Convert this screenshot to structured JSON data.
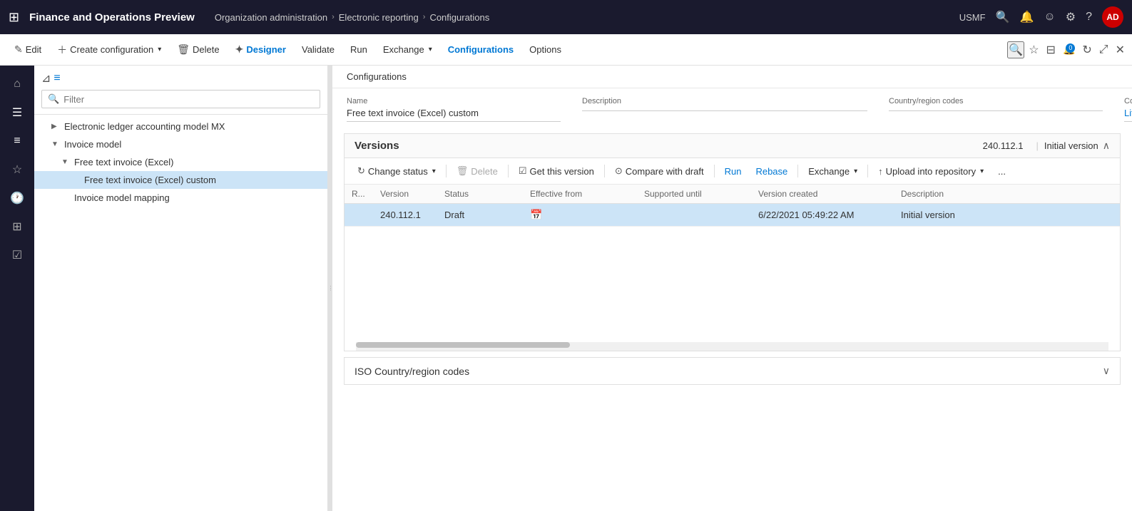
{
  "app": {
    "title": "Finance and Operations Preview",
    "grid_icon": "⊞"
  },
  "breadcrumb": {
    "items": [
      "Organization administration",
      "Electronic reporting",
      "Configurations"
    ]
  },
  "topnav": {
    "org": "USMF",
    "search_icon": "🔍",
    "bell_icon": "🔔",
    "smiley_icon": "☺",
    "gear_icon": "⚙",
    "help_icon": "?",
    "avatar_label": "AD"
  },
  "toolbar": {
    "edit_label": "Edit",
    "create_label": "Create configuration",
    "delete_label": "Delete",
    "designer_label": "Designer",
    "validate_label": "Validate",
    "run_label": "Run",
    "exchange_label": "Exchange",
    "configurations_label": "Configurations",
    "options_label": "Options"
  },
  "nav_filter": {
    "placeholder": "Filter"
  },
  "tree": {
    "items": [
      {
        "label": "Electronic ledger accounting model MX",
        "level": 1,
        "toggle": "▶",
        "expanded": false
      },
      {
        "label": "Invoice model",
        "level": 1,
        "toggle": "▼",
        "expanded": true
      },
      {
        "label": "Free text invoice (Excel)",
        "level": 2,
        "toggle": "▼",
        "expanded": true
      },
      {
        "label": "Free text invoice (Excel) custom",
        "level": 3,
        "toggle": "",
        "selected": true
      },
      {
        "label": "Invoice model mapping",
        "level": 2,
        "toggle": ""
      }
    ]
  },
  "content": {
    "breadcrumb": "Configurations",
    "form": {
      "name_label": "Name",
      "name_value": "Free text invoice (Excel) custom",
      "description_label": "Description",
      "description_value": "",
      "country_label": "Country/region codes",
      "country_value": "",
      "provider_label": "Configuration provider",
      "provider_value": "Litware, Inc."
    },
    "versions": {
      "title": "Versions",
      "badge": "240.112.1",
      "initial": "Initial version",
      "toolbar": {
        "change_status": "Change status",
        "delete": "Delete",
        "get_version": "Get this version",
        "compare": "Compare with draft",
        "run": "Run",
        "rebase": "Rebase",
        "exchange": "Exchange",
        "upload": "Upload into repository",
        "more": "..."
      },
      "table": {
        "headers": [
          "R...",
          "Version",
          "Status",
          "Effective from",
          "Supported until",
          "Version created",
          "Description"
        ],
        "rows": [
          {
            "r": "",
            "version": "240.112.1",
            "status": "Draft",
            "effective_from": "",
            "supported_until": "",
            "version_created": "6/22/2021 05:49:22 AM",
            "description": "Initial version",
            "selected": true
          }
        ]
      }
    },
    "iso": {
      "title": "ISO Country/region codes",
      "expand_icon": "∨"
    }
  }
}
